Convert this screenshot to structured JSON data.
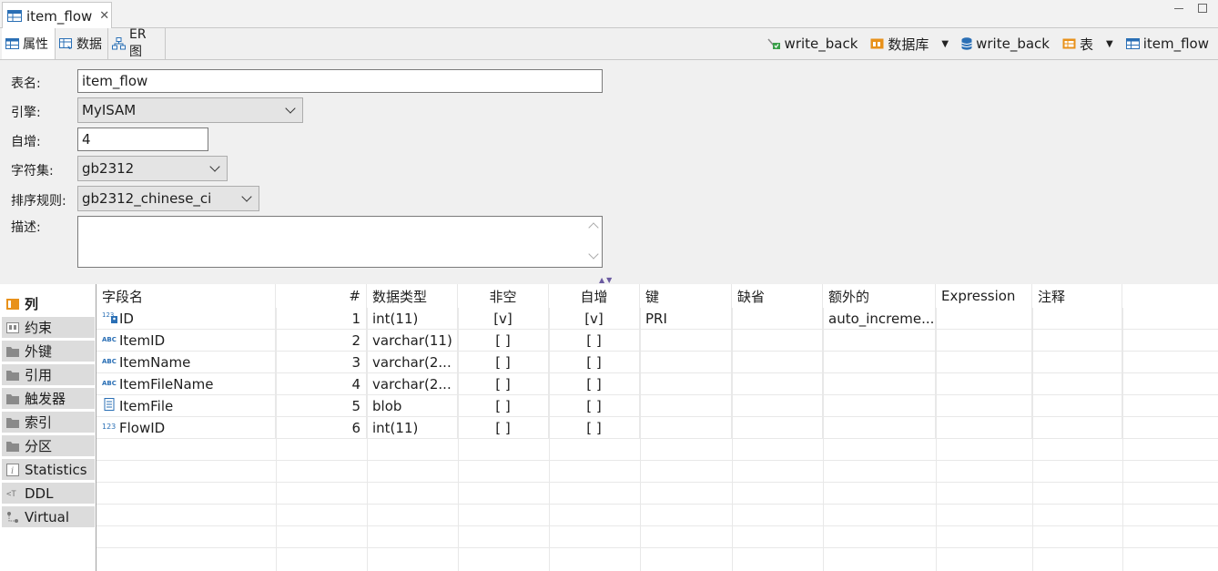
{
  "editor_tab": {
    "title": "item_flow"
  },
  "sub_tabs": [
    {
      "label": "属性"
    },
    {
      "label": "数据"
    },
    {
      "label": "ER 图"
    }
  ],
  "breadcrumbs": [
    {
      "label": "write_back",
      "icon": "connection-icon"
    },
    {
      "label": "数据库",
      "icon": "database-folder-icon",
      "dropdown": true
    },
    {
      "label": "write_back",
      "icon": "database-icon"
    },
    {
      "label": "表",
      "icon": "table-folder-icon",
      "dropdown": true
    },
    {
      "label": "item_flow",
      "icon": "table-icon"
    }
  ],
  "properties": {
    "table_name_label": "表名:",
    "table_name_value": "item_flow",
    "engine_label": "引擎:",
    "engine_value": "MyISAM",
    "auto_increment_label": "自增:",
    "auto_increment_value": "4",
    "charset_label": "字符集:",
    "charset_value": "gb2312",
    "collation_label": "排序规则:",
    "collation_value": "gb2312_chinese_ci",
    "description_label": "描述:",
    "description_value": ""
  },
  "side_tabs": [
    {
      "label": "列",
      "active": true
    },
    {
      "label": "约束"
    },
    {
      "label": "外键"
    },
    {
      "label": "引用"
    },
    {
      "label": "触发器"
    },
    {
      "label": "索引"
    },
    {
      "label": "分区"
    },
    {
      "label": "Statistics"
    },
    {
      "label": "DDL"
    },
    {
      "label": "Virtual"
    }
  ],
  "columns_table": {
    "headers": [
      "字段名",
      "#",
      "数据类型",
      "非空",
      "自增",
      "键",
      "缺省",
      "额外的",
      "Expression",
      "注释"
    ],
    "rows": [
      {
        "name": "ID",
        "type_icon": "key-number-icon",
        "index": "1",
        "data_type": "int(11)",
        "not_null": "[v]",
        "auto_inc": "[v]",
        "key": "PRI",
        "default": "",
        "extra": "auto_increme...",
        "expression": "",
        "comment": ""
      },
      {
        "name": "ItemID",
        "type_icon": "text-type-icon",
        "index": "2",
        "data_type": "varchar(11)",
        "not_null": "[ ]",
        "auto_inc": "[ ]",
        "key": "",
        "default": "",
        "extra": "",
        "expression": "",
        "comment": ""
      },
      {
        "name": "ItemName",
        "type_icon": "text-type-icon",
        "index": "3",
        "data_type": "varchar(2...",
        "not_null": "[ ]",
        "auto_inc": "[ ]",
        "key": "",
        "default": "",
        "extra": "",
        "expression": "",
        "comment": ""
      },
      {
        "name": "ItemFileName",
        "type_icon": "text-type-icon",
        "index": "4",
        "data_type": "varchar(2...",
        "not_null": "[ ]",
        "auto_inc": "[ ]",
        "key": "",
        "default": "",
        "extra": "",
        "expression": "",
        "comment": ""
      },
      {
        "name": "ItemFile",
        "type_icon": "binary-type-icon",
        "index": "5",
        "data_type": "blob",
        "not_null": "[ ]",
        "auto_inc": "[ ]",
        "key": "",
        "default": "",
        "extra": "",
        "expression": "",
        "comment": ""
      },
      {
        "name": "FlowID",
        "type_icon": "number-type-icon",
        "index": "6",
        "data_type": "int(11)",
        "not_null": "[ ]",
        "auto_inc": "[ ]",
        "key": "",
        "default": "",
        "extra": "",
        "expression": "",
        "comment": ""
      }
    ]
  },
  "colors": {
    "table_icon": "#2a6fb5",
    "folder_orange": "#e8911a",
    "type_icon_blue": "#2a6fb5",
    "panel_bg": "#f0f0f0"
  }
}
